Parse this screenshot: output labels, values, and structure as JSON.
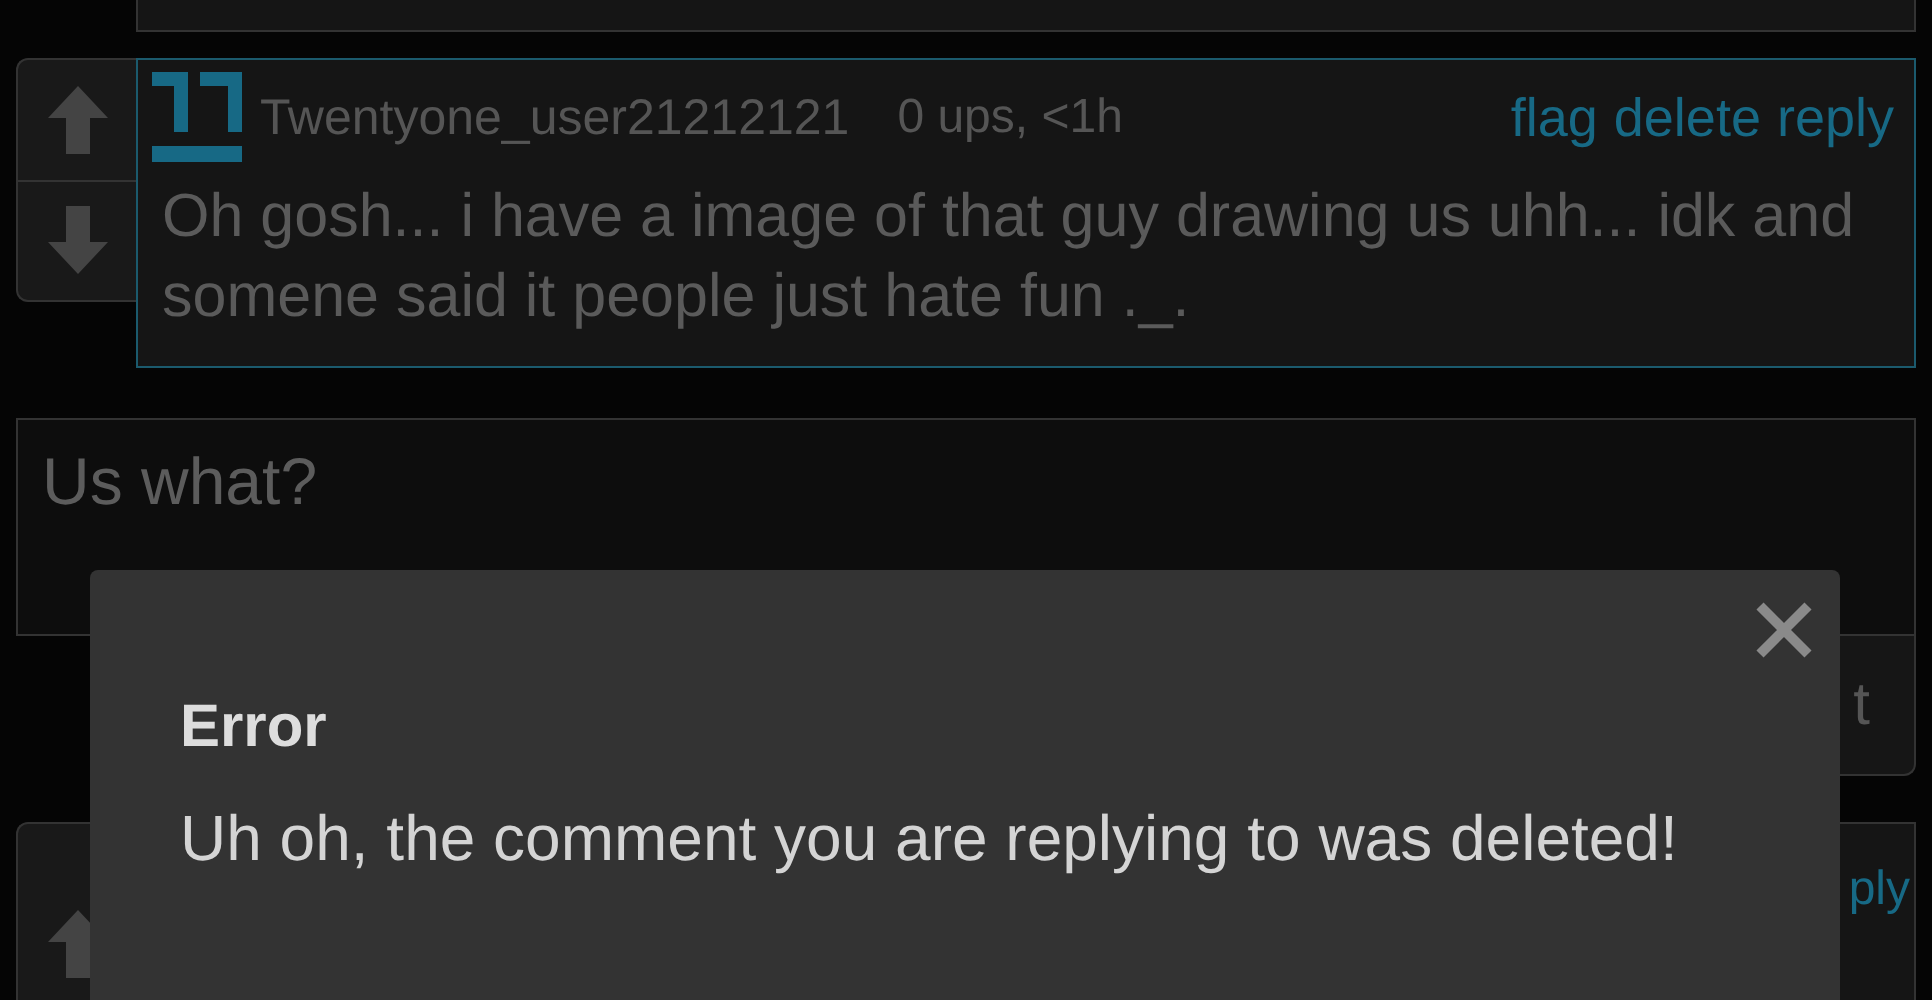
{
  "comment": {
    "username": "Twentyone_user21212121",
    "meta": "0 ups, <1h",
    "actions": [
      "flag",
      "delete",
      "reply"
    ],
    "text": "Oh gosh... i have a image of that guy drawing us uhh... idk and somene said it people just hate fun ._."
  },
  "reply_box": {
    "value": "Us what?"
  },
  "submit_button": {
    "label": "t"
  },
  "next_comment": {
    "actions": [
      "ply"
    ]
  },
  "dialog": {
    "title": "Error",
    "message": "Uh oh, the comment you are replying to was deleted!"
  }
}
